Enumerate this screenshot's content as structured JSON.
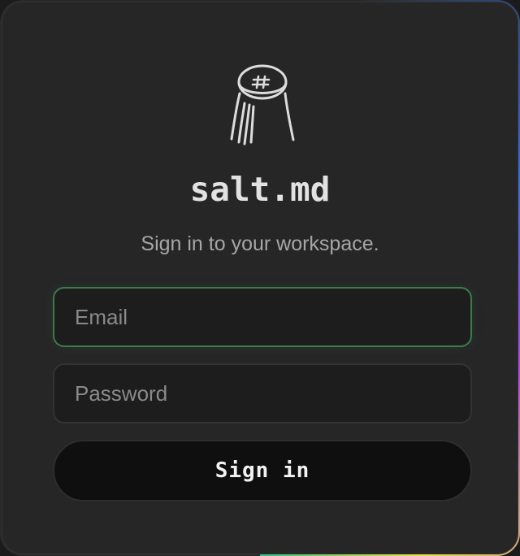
{
  "brand": {
    "name": "salt.md",
    "logo_icon": "salt-shaker-icon"
  },
  "subtitle": "Sign in to your workspace.",
  "form": {
    "email_placeholder": "Email",
    "password_placeholder": "Password",
    "email_value": "",
    "password_value": "",
    "submit_label": "Sign in"
  },
  "colors": {
    "card_background": "#262626",
    "focus_border": "#3c7a4e",
    "button_background": "#0f0f10",
    "title_text": "#e2e2e2"
  }
}
